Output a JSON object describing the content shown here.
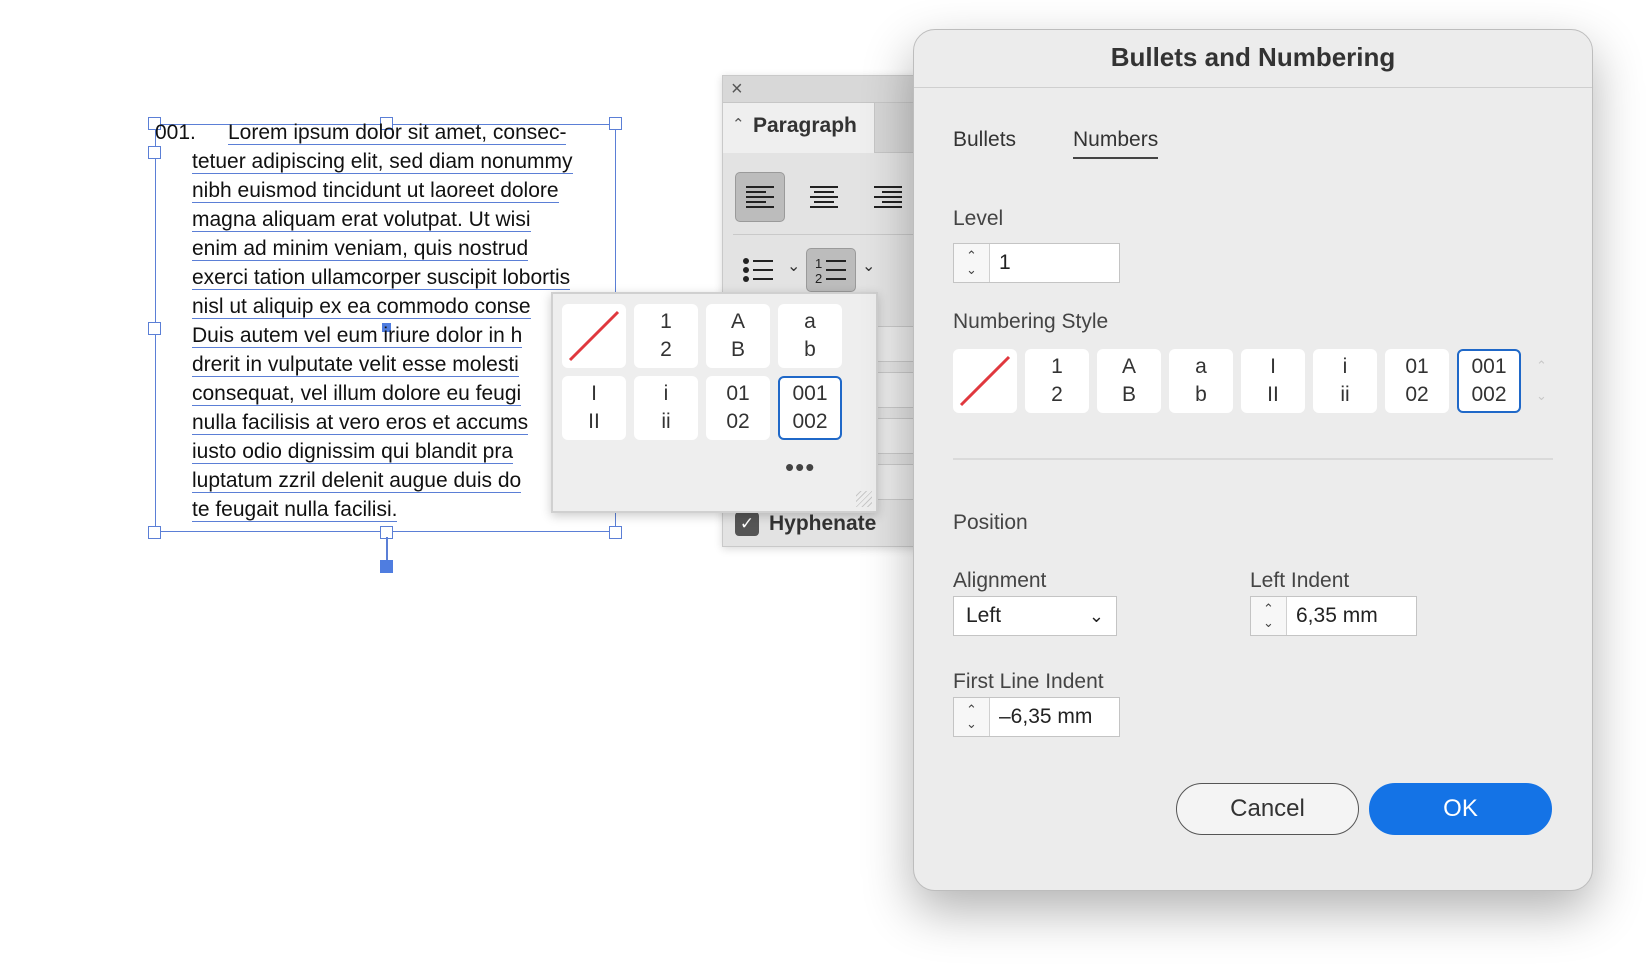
{
  "canvas": {
    "number_label": "001.",
    "text_lines": [
      "Lorem ipsum dolor sit amet, consec-",
      "tetuer adipiscing elit, sed diam nonummy",
      "nibh euismod tincidunt ut laoreet dolore",
      "magna aliquam erat volutpat. Ut wisi",
      "enim ad minim veniam, quis nostrud",
      "exerci tation ullamcorper suscipit lobortis",
      "nisl ut aliquip ex ea commodo conse",
      "Duis autem vel eum iriure dolor in h",
      "drerit in vulputate velit esse molesti",
      "consequat, vel illum dolore eu feugi",
      "nulla facilisis at vero eros et accums",
      "iusto odio dignissim qui blandit pra",
      "luptatum zzril delenit augue duis do",
      "te feugait nulla facilisi."
    ]
  },
  "paragraph_panel": {
    "close_icon": "×",
    "tab_label": "Paragraph",
    "hyphenate_label": "Hyphenate",
    "hyphenate_checked": true
  },
  "popover": {
    "styles": [
      {
        "id": "none",
        "line1": "",
        "line2": ""
      },
      {
        "id": "arabic",
        "line1": "1",
        "line2": "2"
      },
      {
        "id": "upper-alpha",
        "line1": "A",
        "line2": "B"
      },
      {
        "id": "lower-alpha",
        "line1": "a",
        "line2": "b"
      },
      {
        "id": "upper-roman",
        "line1": "I",
        "line2": "II"
      },
      {
        "id": "lower-roman",
        "line1": "i",
        "line2": "ii"
      },
      {
        "id": "two-digit",
        "line1": "01",
        "line2": "02"
      },
      {
        "id": "three-digit",
        "line1": "001",
        "line2": "002"
      }
    ],
    "selected": "three-digit",
    "more_label": "•••"
  },
  "dialog": {
    "title": "Bullets and Numbering",
    "tabs": [
      {
        "label": "Bullets",
        "active": false
      },
      {
        "label": "Numbers",
        "active": true
      }
    ],
    "level_label": "Level",
    "level_value": "1",
    "numbering_style_label": "Numbering Style",
    "numbering_styles": [
      {
        "id": "none",
        "line1": "",
        "line2": ""
      },
      {
        "id": "arabic",
        "line1": "1",
        "line2": "2"
      },
      {
        "id": "upper-alpha",
        "line1": "A",
        "line2": "B"
      },
      {
        "id": "lower-alpha",
        "line1": "a",
        "line2": "b"
      },
      {
        "id": "upper-roman",
        "line1": "I",
        "line2": "II"
      },
      {
        "id": "lower-roman",
        "line1": "i",
        "line2": "ii"
      },
      {
        "id": "two-digit",
        "line1": "01",
        "line2": "02"
      },
      {
        "id": "three-digit",
        "line1": "001",
        "line2": "002"
      }
    ],
    "selected_style": "three-digit",
    "position_label": "Position",
    "alignment_label": "Alignment",
    "alignment_value": "Left",
    "left_indent_label": "Left Indent",
    "left_indent_value": "6,35 mm",
    "first_line_indent_label": "First Line Indent",
    "first_line_indent_value": "–6,35 mm",
    "cancel_label": "Cancel",
    "ok_label": "OK"
  },
  "colors": {
    "accent": "#1473e6",
    "selection": "#5b7fd6",
    "none_slash": "#e0383e"
  }
}
